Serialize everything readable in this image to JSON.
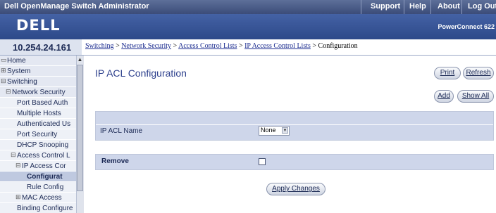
{
  "header": {
    "app_title": "Dell OpenManage Switch Administrator",
    "links": [
      "Support",
      "Help",
      "About",
      "Log Out"
    ],
    "logo_text": "DELL",
    "model": "PowerConnect 622"
  },
  "ip_address": "10.254.24.161",
  "breadcrumb": {
    "items": [
      "Switching",
      "Network Security",
      "Access Control Lists",
      "IP Access Control Lists"
    ],
    "separator": " > ",
    "current": "Configuration"
  },
  "sidebar": {
    "items": [
      {
        "label": "Home",
        "toggle": "",
        "indent": 0
      },
      {
        "label": "System",
        "toggle": "⊞",
        "indent": 0
      },
      {
        "label": "Switching",
        "toggle": "⊟",
        "indent": 0
      },
      {
        "label": "Network Security",
        "toggle": "⊟",
        "indent": 1
      },
      {
        "label": "Port Based Auth",
        "toggle": "",
        "indent": 2
      },
      {
        "label": "Multiple Hosts",
        "toggle": "",
        "indent": 2
      },
      {
        "label": "Authenticated Us",
        "toggle": "",
        "indent": 2
      },
      {
        "label": "Port Security",
        "toggle": "",
        "indent": 2
      },
      {
        "label": "DHCP Snooping",
        "toggle": "",
        "indent": 2
      },
      {
        "label": "Access Control L",
        "toggle": "⊟",
        "indent": 2
      },
      {
        "label": "IP Access Cor",
        "toggle": "⊟",
        "indent": 3
      },
      {
        "label": "Configurat",
        "toggle": "",
        "indent": 4,
        "selected": true
      },
      {
        "label": "Rule Config",
        "toggle": "",
        "indent": 4
      },
      {
        "label": "MAC Access",
        "toggle": "⊞",
        "indent": 3
      },
      {
        "label": "Binding Configure",
        "toggle": "",
        "indent": 2
      }
    ]
  },
  "main": {
    "title": "IP ACL Configuration",
    "buttons": {
      "print": "Print",
      "refresh": "Refresh",
      "add": "Add",
      "show_all": "Show All",
      "apply": "Apply Changes"
    },
    "fields": {
      "ip_acl_name": {
        "label": "IP ACL Name",
        "value": "None"
      },
      "remove": {
        "label": "Remove",
        "checked": false
      }
    }
  }
}
